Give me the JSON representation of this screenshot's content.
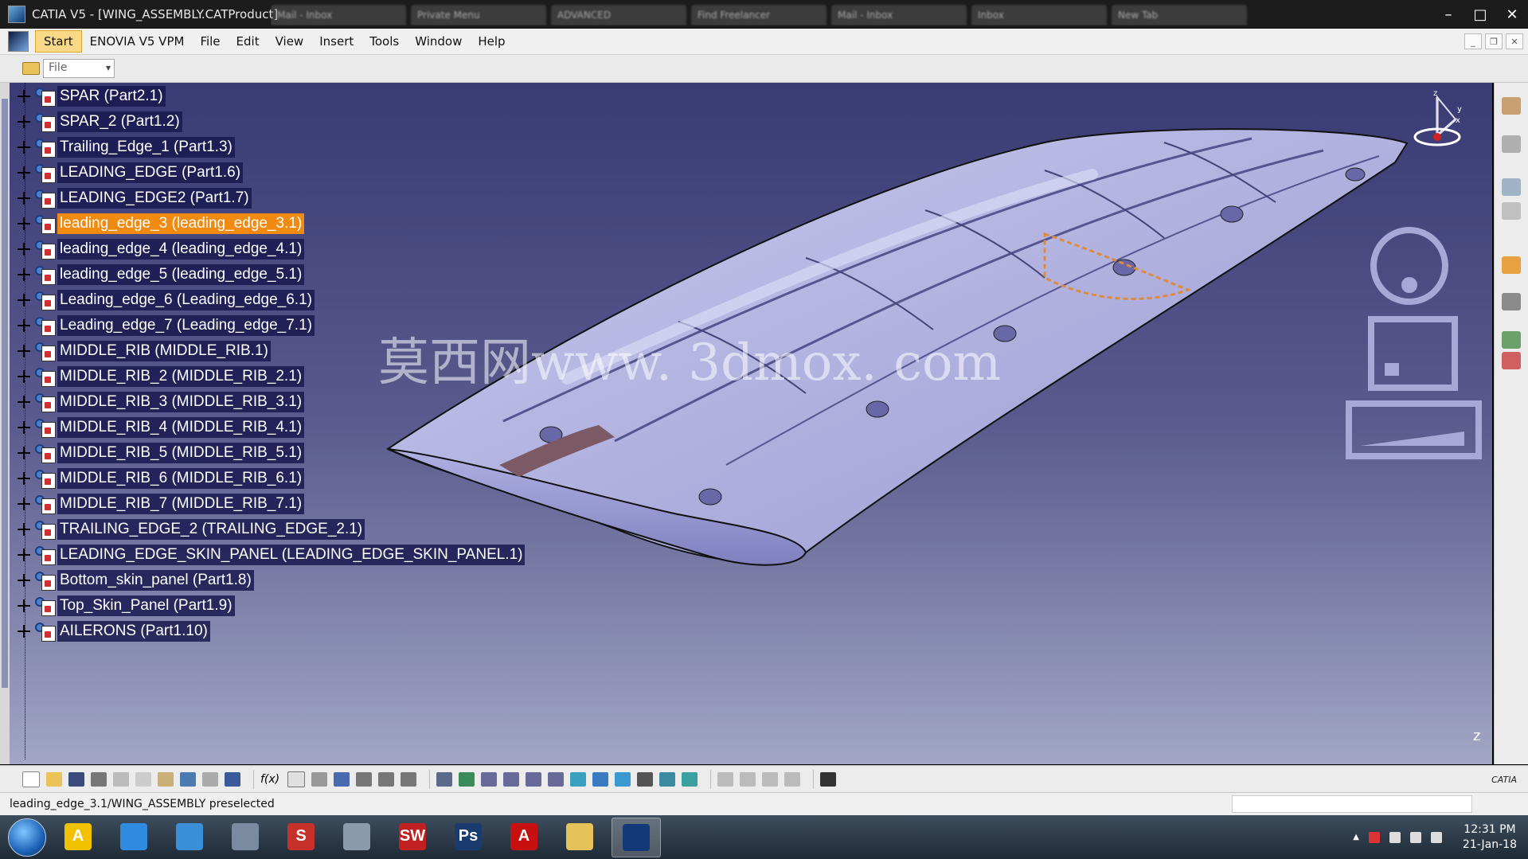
{
  "window": {
    "title": "CATIA V5 - [WING_ASSEMBLY.CATProduct]",
    "tabs": [
      "Mail - Inbox",
      "Private Menu",
      "ADVANCED",
      "Find Freelancer",
      "Mail - Inbox",
      "Inbox",
      "New Tab"
    ],
    "min_glyph": "–",
    "max_glyph": "□",
    "close_glyph": "✕"
  },
  "menu": {
    "items": [
      "Start",
      "ENOVIA V5 VPM",
      "File",
      "Edit",
      "View",
      "Insert",
      "Tools",
      "Window",
      "Help"
    ],
    "mdi_min": "_",
    "mdi_restore": "❐",
    "mdi_close": "✕"
  },
  "filebar": {
    "select_value": "File"
  },
  "tree": {
    "items": [
      {
        "label": "SPAR (Part2.1)",
        "selected": false
      },
      {
        "label": "SPAR_2 (Part1.2)",
        "selected": false
      },
      {
        "label": "Trailing_Edge_1 (Part1.3)",
        "selected": false
      },
      {
        "label": "LEADING_EDGE (Part1.6)",
        "selected": false
      },
      {
        "label": "LEADING_EDGE2 (Part1.7)",
        "selected": false
      },
      {
        "label": "leading_edge_3 (leading_edge_3.1)",
        "selected": true
      },
      {
        "label": "leading_edge_4 (leading_edge_4.1)",
        "selected": false
      },
      {
        "label": "leading_edge_5 (leading_edge_5.1)",
        "selected": false
      },
      {
        "label": "Leading_edge_6 (Leading_edge_6.1)",
        "selected": false
      },
      {
        "label": "Leading_edge_7 (Leading_edge_7.1)",
        "selected": false
      },
      {
        "label": "MIDDLE_RIB (MIDDLE_RIB.1)",
        "selected": false
      },
      {
        "label": "MIDDLE_RIB_2 (MIDDLE_RIB_2.1)",
        "selected": false
      },
      {
        "label": "MIDDLE_RIB_3 (MIDDLE_RIB_3.1)",
        "selected": false
      },
      {
        "label": "MIDDLE_RIB_4 (MIDDLE_RIB_4.1)",
        "selected": false
      },
      {
        "label": "MIDDLE_RIB_5 (MIDDLE_RIB_5.1)",
        "selected": false
      },
      {
        "label": "MIDDLE_RIB_6 (MIDDLE_RIB_6.1)",
        "selected": false
      },
      {
        "label": "MIDDLE_RIB_7 (MIDDLE_RIB_7.1)",
        "selected": false
      },
      {
        "label": "TRAILING_EDGE_2 (TRAILING_EDGE_2.1)",
        "selected": false
      },
      {
        "label": "LEADING_EDGE_SKIN_PANEL (LEADING_EDGE_SKIN_PANEL.1)",
        "selected": false
      },
      {
        "label": "Bottom_skin_panel (Part1.8)",
        "selected": false
      },
      {
        "label": "Top_Skin_Panel (Part1.9)",
        "selected": false
      },
      {
        "label": "AILERONS (Part1.10)",
        "selected": false
      }
    ]
  },
  "viewport": {
    "watermark": "莫西网www. 3dmox. com",
    "compass_axes": [
      "z",
      "y",
      "x"
    ],
    "corner_glyph": "z"
  },
  "status": {
    "text": "leading_edge_3.1/WING_ASSEMBLY preselected"
  },
  "toolbar": {
    "fo_label": "f(x)",
    "catia_logo": "CATIA"
  },
  "taskbar": {
    "apps": [
      {
        "name": "autodesk",
        "glyph": "A",
        "color": "#f2c200"
      },
      {
        "name": "chrome",
        "glyph": "",
        "color": "#2e8be0"
      },
      {
        "name": "explorer-window",
        "glyph": "",
        "color": "#3a8fd8"
      },
      {
        "name": "catia-alt",
        "glyph": "",
        "color": "#7a8aa0"
      },
      {
        "name": "sketchup",
        "glyph": "S",
        "color": "#c8312a"
      },
      {
        "name": "creo",
        "glyph": "",
        "color": "#8a9aaa"
      },
      {
        "name": "solidworks",
        "glyph": "SW",
        "color": "#c02020"
      },
      {
        "name": "photoshop",
        "glyph": "Ps",
        "color": "#1a3b6e"
      },
      {
        "name": "acrobat",
        "glyph": "A",
        "color": "#c81010"
      },
      {
        "name": "file-explorer",
        "glyph": "",
        "color": "#e6c25a"
      },
      {
        "name": "catia",
        "glyph": "",
        "color": "#123a78"
      }
    ],
    "time": "12:31 PM",
    "date": "21-Jan-18"
  }
}
